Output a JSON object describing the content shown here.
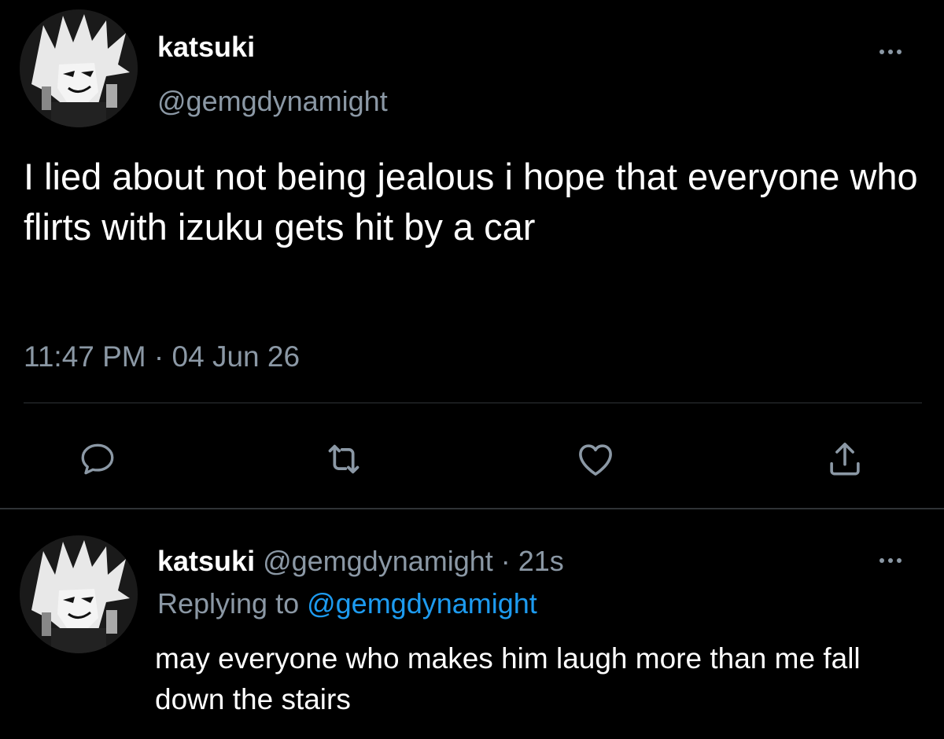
{
  "colors": {
    "background": "#000000",
    "primary_text": "#ffffff",
    "secondary_text": "#8b98a5",
    "link": "#1d9bf0",
    "divider": "#2f3336"
  },
  "tweet": {
    "author": {
      "display_name": "katsuki",
      "handle": "@gemgdynamight",
      "avatar_icon": "manga-avatar-icon"
    },
    "more_icon": "more-options-icon",
    "text": "I lied about not being jealous i hope that everyone who flirts with izuku gets hit by a car",
    "timestamp": "11:47 PM · 04 Jun 26",
    "actions": [
      {
        "name": "reply",
        "icon": "reply-bubble-icon"
      },
      {
        "name": "retweet",
        "icon": "retweet-icon"
      },
      {
        "name": "like",
        "icon": "heart-icon"
      },
      {
        "name": "share",
        "icon": "share-icon"
      }
    ]
  },
  "reply": {
    "author": {
      "display_name": "katsuki",
      "meta": " @gemgdynamight · 21s",
      "avatar_icon": "manga-avatar-icon"
    },
    "replying_label": "Replying to ",
    "replying_mention": "@gemgdynamight",
    "more_icon": "more-options-icon",
    "text": "may everyone who makes him laugh more than me fall down the stairs"
  }
}
